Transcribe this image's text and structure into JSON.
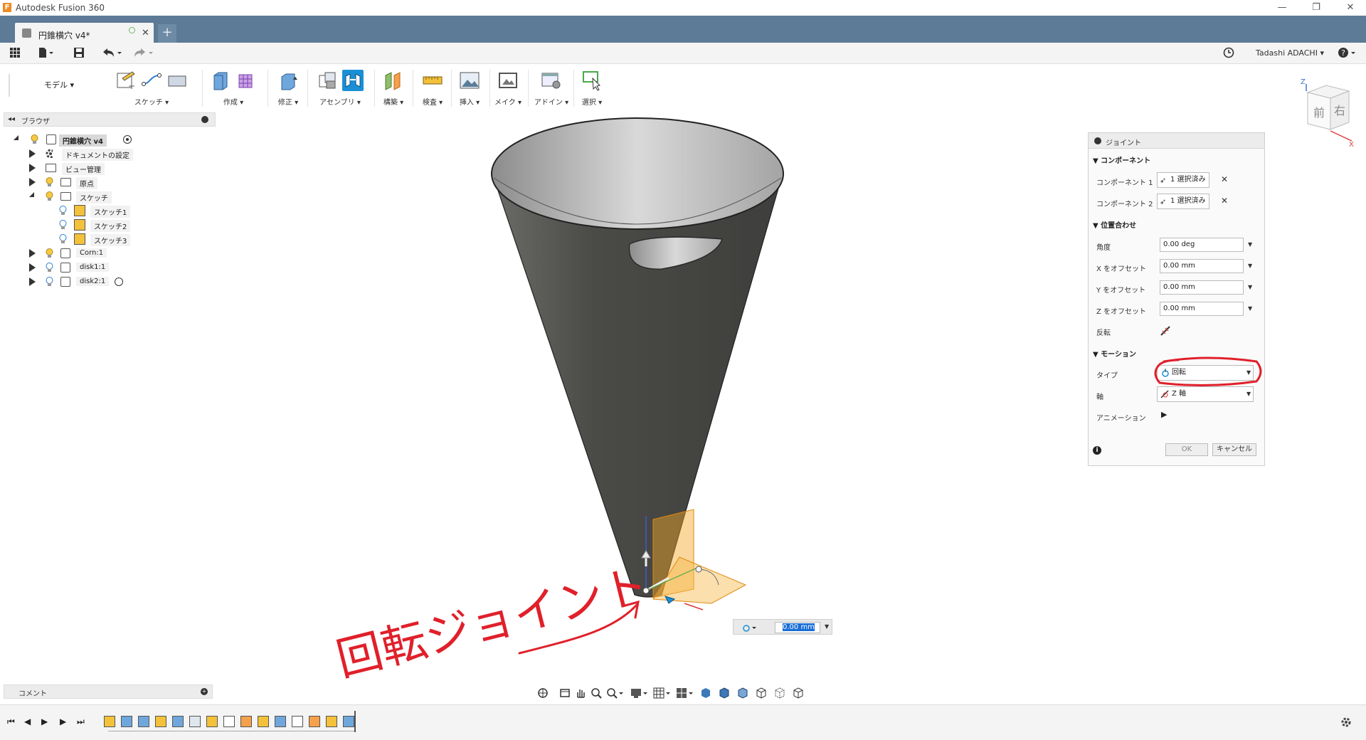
{
  "window": {
    "app_title": "Autodesk Fusion 360",
    "app_icon_letter": "F",
    "minimize": "—",
    "restore": "❐",
    "close": "✕"
  },
  "tabs": {
    "active_label": "円錐横穴 v4*",
    "new_tab": "+"
  },
  "quickbar": {
    "user_name": "Tadashi ADACHI ▾",
    "help": "?"
  },
  "toolbar": {
    "workspace": "モデル ▾",
    "groups": [
      "スケッチ ▾",
      "作成 ▾",
      "修正 ▾",
      "アセンブリ ▾",
      "構築 ▾",
      "検査 ▾",
      "挿入 ▾",
      "メイク ▾",
      "アドイン ▾",
      "選択 ▾"
    ]
  },
  "browser": {
    "title": "ブラウザ",
    "items": [
      {
        "label": "円錐横穴 v4"
      },
      {
        "label": "ドキュメントの設定"
      },
      {
        "label": "ビュー管理"
      },
      {
        "label": "原点"
      },
      {
        "label": "スケッチ"
      },
      {
        "label": "スケッチ1"
      },
      {
        "label": "スケッチ2"
      },
      {
        "label": "スケッチ3"
      },
      {
        "label": "Corn:1"
      },
      {
        "label": "disk1:1"
      },
      {
        "label": "disk2:1"
      }
    ]
  },
  "dialog": {
    "title": "ジョイント",
    "section_components": "コンポーネント",
    "component1_label": "コンポーネント 1",
    "component2_label": "コンポーネント 2",
    "selected_text": "1 選択済み",
    "section_alignment": "位置合わせ",
    "angle_label": "角度",
    "angle_value": "0.00 deg",
    "x_offset_label": "X をオフセット",
    "x_offset_value": "0.00 mm",
    "y_offset_label": "Y をオフセット",
    "y_offset_value": "0.00 mm",
    "z_offset_label": "Z をオフセット",
    "z_offset_value": "0.00 mm",
    "flip_label": "反転",
    "section_motion": "モーション",
    "type_label": "タイプ",
    "type_value": "回転",
    "axis_label": "軸",
    "axis_value": "Z 軸",
    "animation_label": "アニメーション",
    "ok": "OK",
    "cancel": "キャンセル"
  },
  "annotation": {
    "handwritten_text": "回転ジョイント"
  },
  "viewport": {
    "gizmo_value": "0.00 mm"
  },
  "viewcube": {
    "front": "前",
    "right": "右",
    "axis_z": "Z",
    "axis_x": "X"
  },
  "comments": {
    "title": "コメント"
  },
  "colors": {
    "tab_bar": "#5d7a96",
    "accent_blue": "#1a8fd6",
    "cone": "#4a4a48",
    "annotation_red": "#e0202a",
    "joint_orange": "#f5a623"
  }
}
